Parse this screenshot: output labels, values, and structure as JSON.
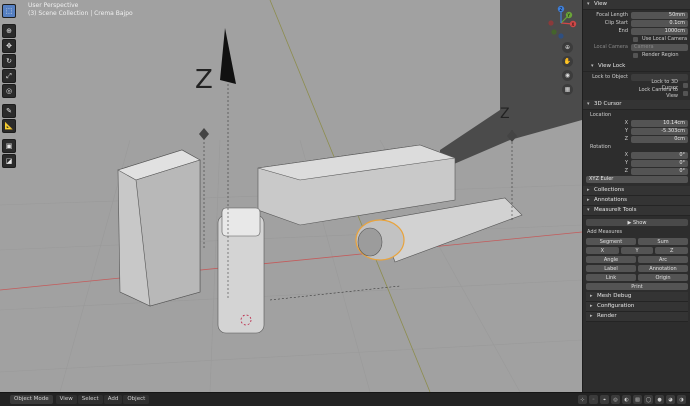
{
  "viewport": {
    "title": "User Perspective",
    "collection": "(3) Scene Collection | Crema Bajpo",
    "axis_label": "Z"
  },
  "toolbar": {
    "icons": [
      "select-box-icon",
      "cursor-icon",
      "move-icon",
      "rotate-icon",
      "scale-icon",
      "transform-icon",
      "annotate-icon",
      "measure-icon",
      "add-cube-icon",
      "camera-icon"
    ]
  },
  "gizmo": {
    "x": "X",
    "y": "Y",
    "z": "Z"
  },
  "panel": {
    "view": {
      "header": "View",
      "focal_length_label": "Focal Length",
      "focal_length": "50mm",
      "clip_start_label": "Clip Start",
      "clip_start": "0.1cm",
      "clip_end_label": "End",
      "clip_end": "1000cm",
      "use_local_camera": "Use Local Camera",
      "local_camera_label": "Local Camera",
      "local_camera": "Camera",
      "render_region": "Render Region",
      "view_lock_header": "View Lock",
      "lock_to_object": "Lock to Object",
      "lock_to_3d_cursor": "Lock to 3D Cursor",
      "lock_camera_to_view": "Lock Camera to View"
    },
    "cursor": {
      "header": "3D Cursor",
      "location_label": "Location",
      "x_label": "X",
      "x": "10.14cm",
      "y_label": "Y",
      "y": "-5.303cm",
      "z_label": "Z",
      "z": "0cm",
      "rotation_label": "Rotation",
      "rx": "0°",
      "ry": "0°",
      "rz": "0°",
      "mode": "XYZ Euler"
    },
    "collections": "Collections",
    "annotations": "Annotations",
    "measureit": {
      "header": "MeasureIt Tools",
      "show": "Show",
      "add_measures": "Add Measures",
      "segment": "Segment",
      "sum": "Sum",
      "angle": "Angle",
      "arc": "Arc",
      "label": "Label",
      "annotation": "Annotation",
      "link": "Link",
      "origin": "Origin",
      "print": "Print",
      "mesh_debug": "Mesh Debug",
      "configuration": "Configuration",
      "render": "Render"
    }
  },
  "statusbar": {
    "mode": "Object Mode",
    "menu": [
      "View",
      "Select",
      "Add",
      "Object"
    ],
    "global": "Global"
  }
}
